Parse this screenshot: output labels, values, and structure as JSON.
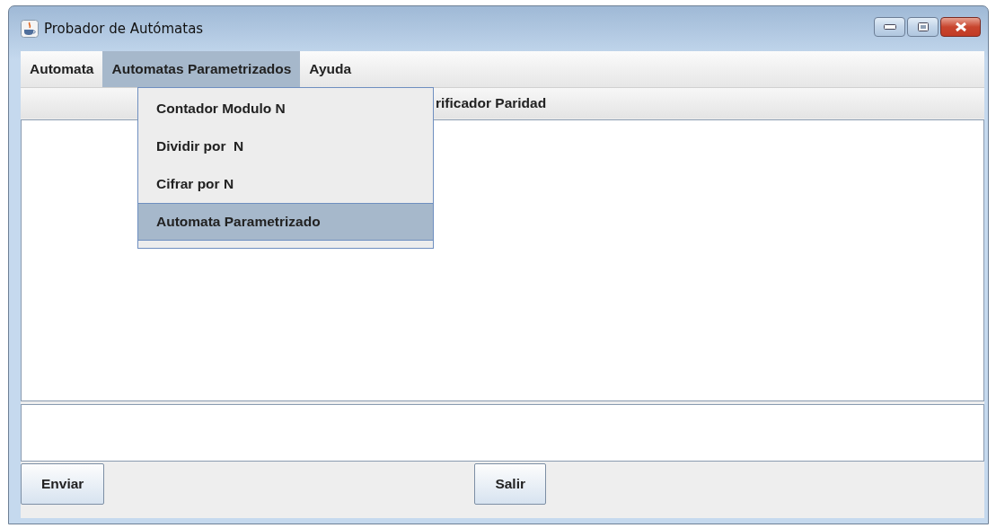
{
  "window": {
    "title": "Probador de Autómatas"
  },
  "menu_bar": [
    {
      "label": "Automata",
      "selected": false
    },
    {
      "label": "Automatas Parametrizados",
      "selected": true
    },
    {
      "label": "Ayuda",
      "selected": false
    }
  ],
  "open_menu": {
    "items": [
      {
        "label": "Contador Modulo N",
        "selected": false
      },
      {
        "label": "Dividir por  N",
        "selected": false
      },
      {
        "label": "Cifrar por N",
        "selected": false
      },
      {
        "label": "Automata Parametrizado",
        "selected": true
      }
    ]
  },
  "header_label": "rificador Paridad",
  "buttons": [
    {
      "label": "Enviar"
    },
    {
      "label": "Salir"
    }
  ]
}
